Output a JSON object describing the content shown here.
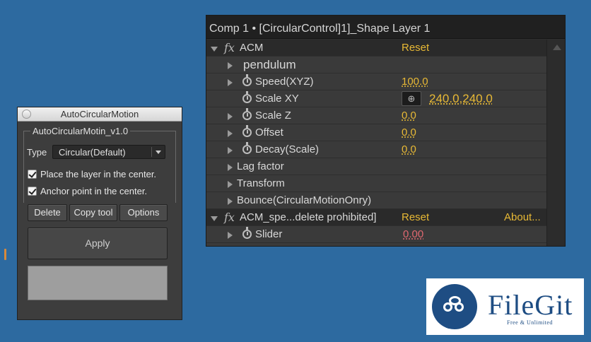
{
  "effect_controls": {
    "header_title": "Comp 1 • [CircularControl]1]_Shape Layer 1",
    "effects": [
      {
        "name": "ACM",
        "reset_label": "Reset",
        "rows": [
          {
            "label": "pendulum",
            "value": ""
          },
          {
            "label": "Speed(XYZ)",
            "value": "100.0"
          },
          {
            "label": "Scale XY",
            "value": "240.0,240.0"
          },
          {
            "label": "Scale  Z",
            "value": "0.0"
          },
          {
            "label": "Offset",
            "value": "0.0"
          },
          {
            "label": "Decay(Scale)",
            "value": "0.0"
          },
          {
            "label": "Lag factor",
            "value": ""
          },
          {
            "label": "Transform",
            "value": ""
          },
          {
            "label": "Bounce(CircularMotionOnry)",
            "value": ""
          }
        ]
      },
      {
        "name": "ACM_spe...delete prohibited]",
        "reset_label": "Reset",
        "about_label": "About...",
        "rows": [
          {
            "label": "Slider",
            "value": "0.00"
          }
        ]
      }
    ],
    "colors": {
      "value": "#e8b935",
      "value_red": "#e06870"
    }
  },
  "acm_window": {
    "title": "AutoCircularMotion",
    "group_title": "AutoCircularMotin_v1.0",
    "type_label": "Type",
    "type_value": "Circular(Default)",
    "checkboxes": [
      {
        "label": "Place the layer in the center.",
        "checked": true
      },
      {
        "label": "Anchor point in the center.",
        "checked": true
      }
    ],
    "buttons": {
      "delete": "Delete",
      "copy_tool": "Copy tool",
      "options": "Options"
    },
    "apply_label": "Apply"
  },
  "watermark": {
    "name": "FileGit",
    "tagline": "Free & Unlimited",
    "icon": "cloud-binoculars-icon"
  }
}
